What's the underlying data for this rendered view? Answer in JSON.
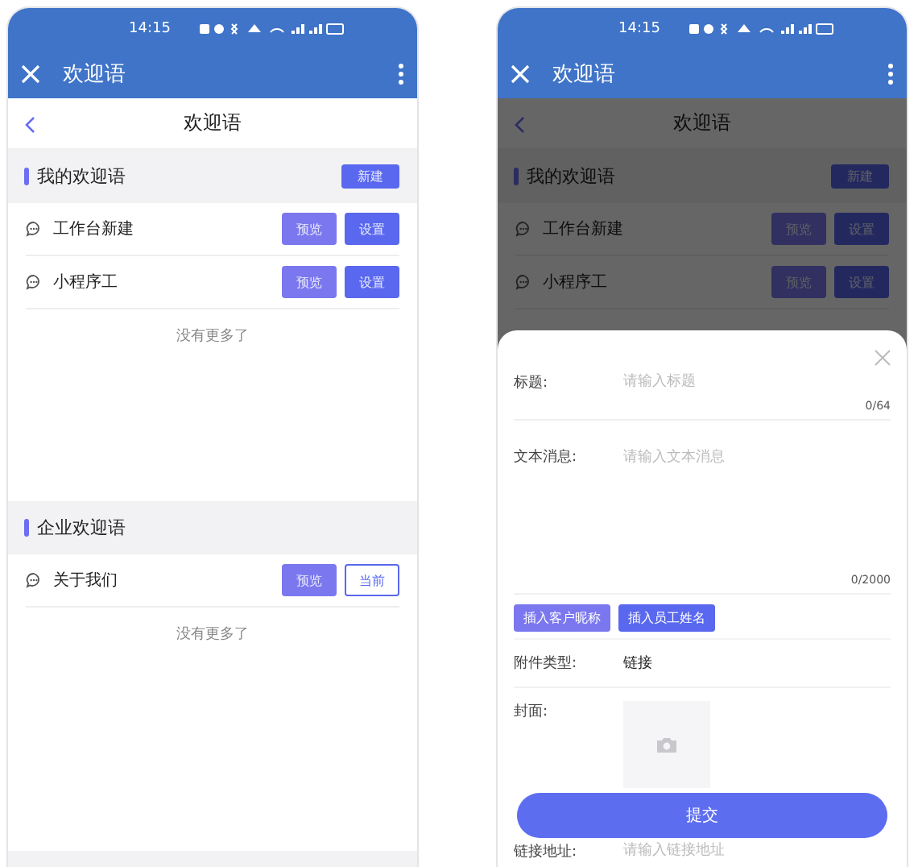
{
  "screens": [
    {
      "status_bar": {
        "time": "14:15"
      },
      "app_bar": {
        "title": "欢迎语"
      },
      "page_title": "欢迎语",
      "dimmed": false,
      "sections": [
        {
          "title": "我的欢迎语",
          "action": "新建",
          "items": [
            {
              "name": "工作台新建",
              "buttons": [
                {
                  "label": "预览",
                  "kind": "light"
                },
                {
                  "label": "设置",
                  "kind": "primary"
                }
              ]
            },
            {
              "name": "小程序工",
              "buttons": [
                {
                  "label": "预览",
                  "kind": "light"
                },
                {
                  "label": "设置",
                  "kind": "primary"
                }
              ]
            }
          ],
          "footer": "没有更多了"
        },
        {
          "title": "企业欢迎语",
          "items": [
            {
              "name": "关于我们",
              "buttons": [
                {
                  "label": "预览",
                  "kind": "light"
                },
                {
                  "label": "当前",
                  "kind": "outline"
                }
              ]
            }
          ],
          "footer": "没有更多了"
        }
      ]
    },
    {
      "status_bar": {
        "time": "14:15"
      },
      "app_bar": {
        "title": "欢迎语"
      },
      "page_title": "欢迎语",
      "dimmed": true,
      "sections": [
        {
          "title": "我的欢迎语",
          "action": "新建",
          "items": [
            {
              "name": "工作台新建",
              "buttons": [
                {
                  "label": "预览",
                  "kind": "light"
                },
                {
                  "label": "设置",
                  "kind": "primary"
                }
              ]
            },
            {
              "name": "小程序工",
              "buttons": [
                {
                  "label": "预览",
                  "kind": "light"
                },
                {
                  "label": "设置",
                  "kind": "primary"
                }
              ]
            }
          ]
        }
      ],
      "sheet": {
        "title_field": {
          "label": "标题:",
          "placeholder": "请输入标题",
          "counter": "0/64"
        },
        "message_field": {
          "label": "文本消息:",
          "placeholder": "请输入文本消息",
          "counter": "0/2000"
        },
        "insert_buttons": [
          "插入客户昵称",
          "插入员工姓名"
        ],
        "attachment": {
          "label": "附件类型:",
          "value": "链接"
        },
        "cover": {
          "label": "封面:"
        },
        "link_field": {
          "label": "链接地址:",
          "placeholder": "请输入链接地址"
        },
        "submit": "提交"
      }
    }
  ]
}
